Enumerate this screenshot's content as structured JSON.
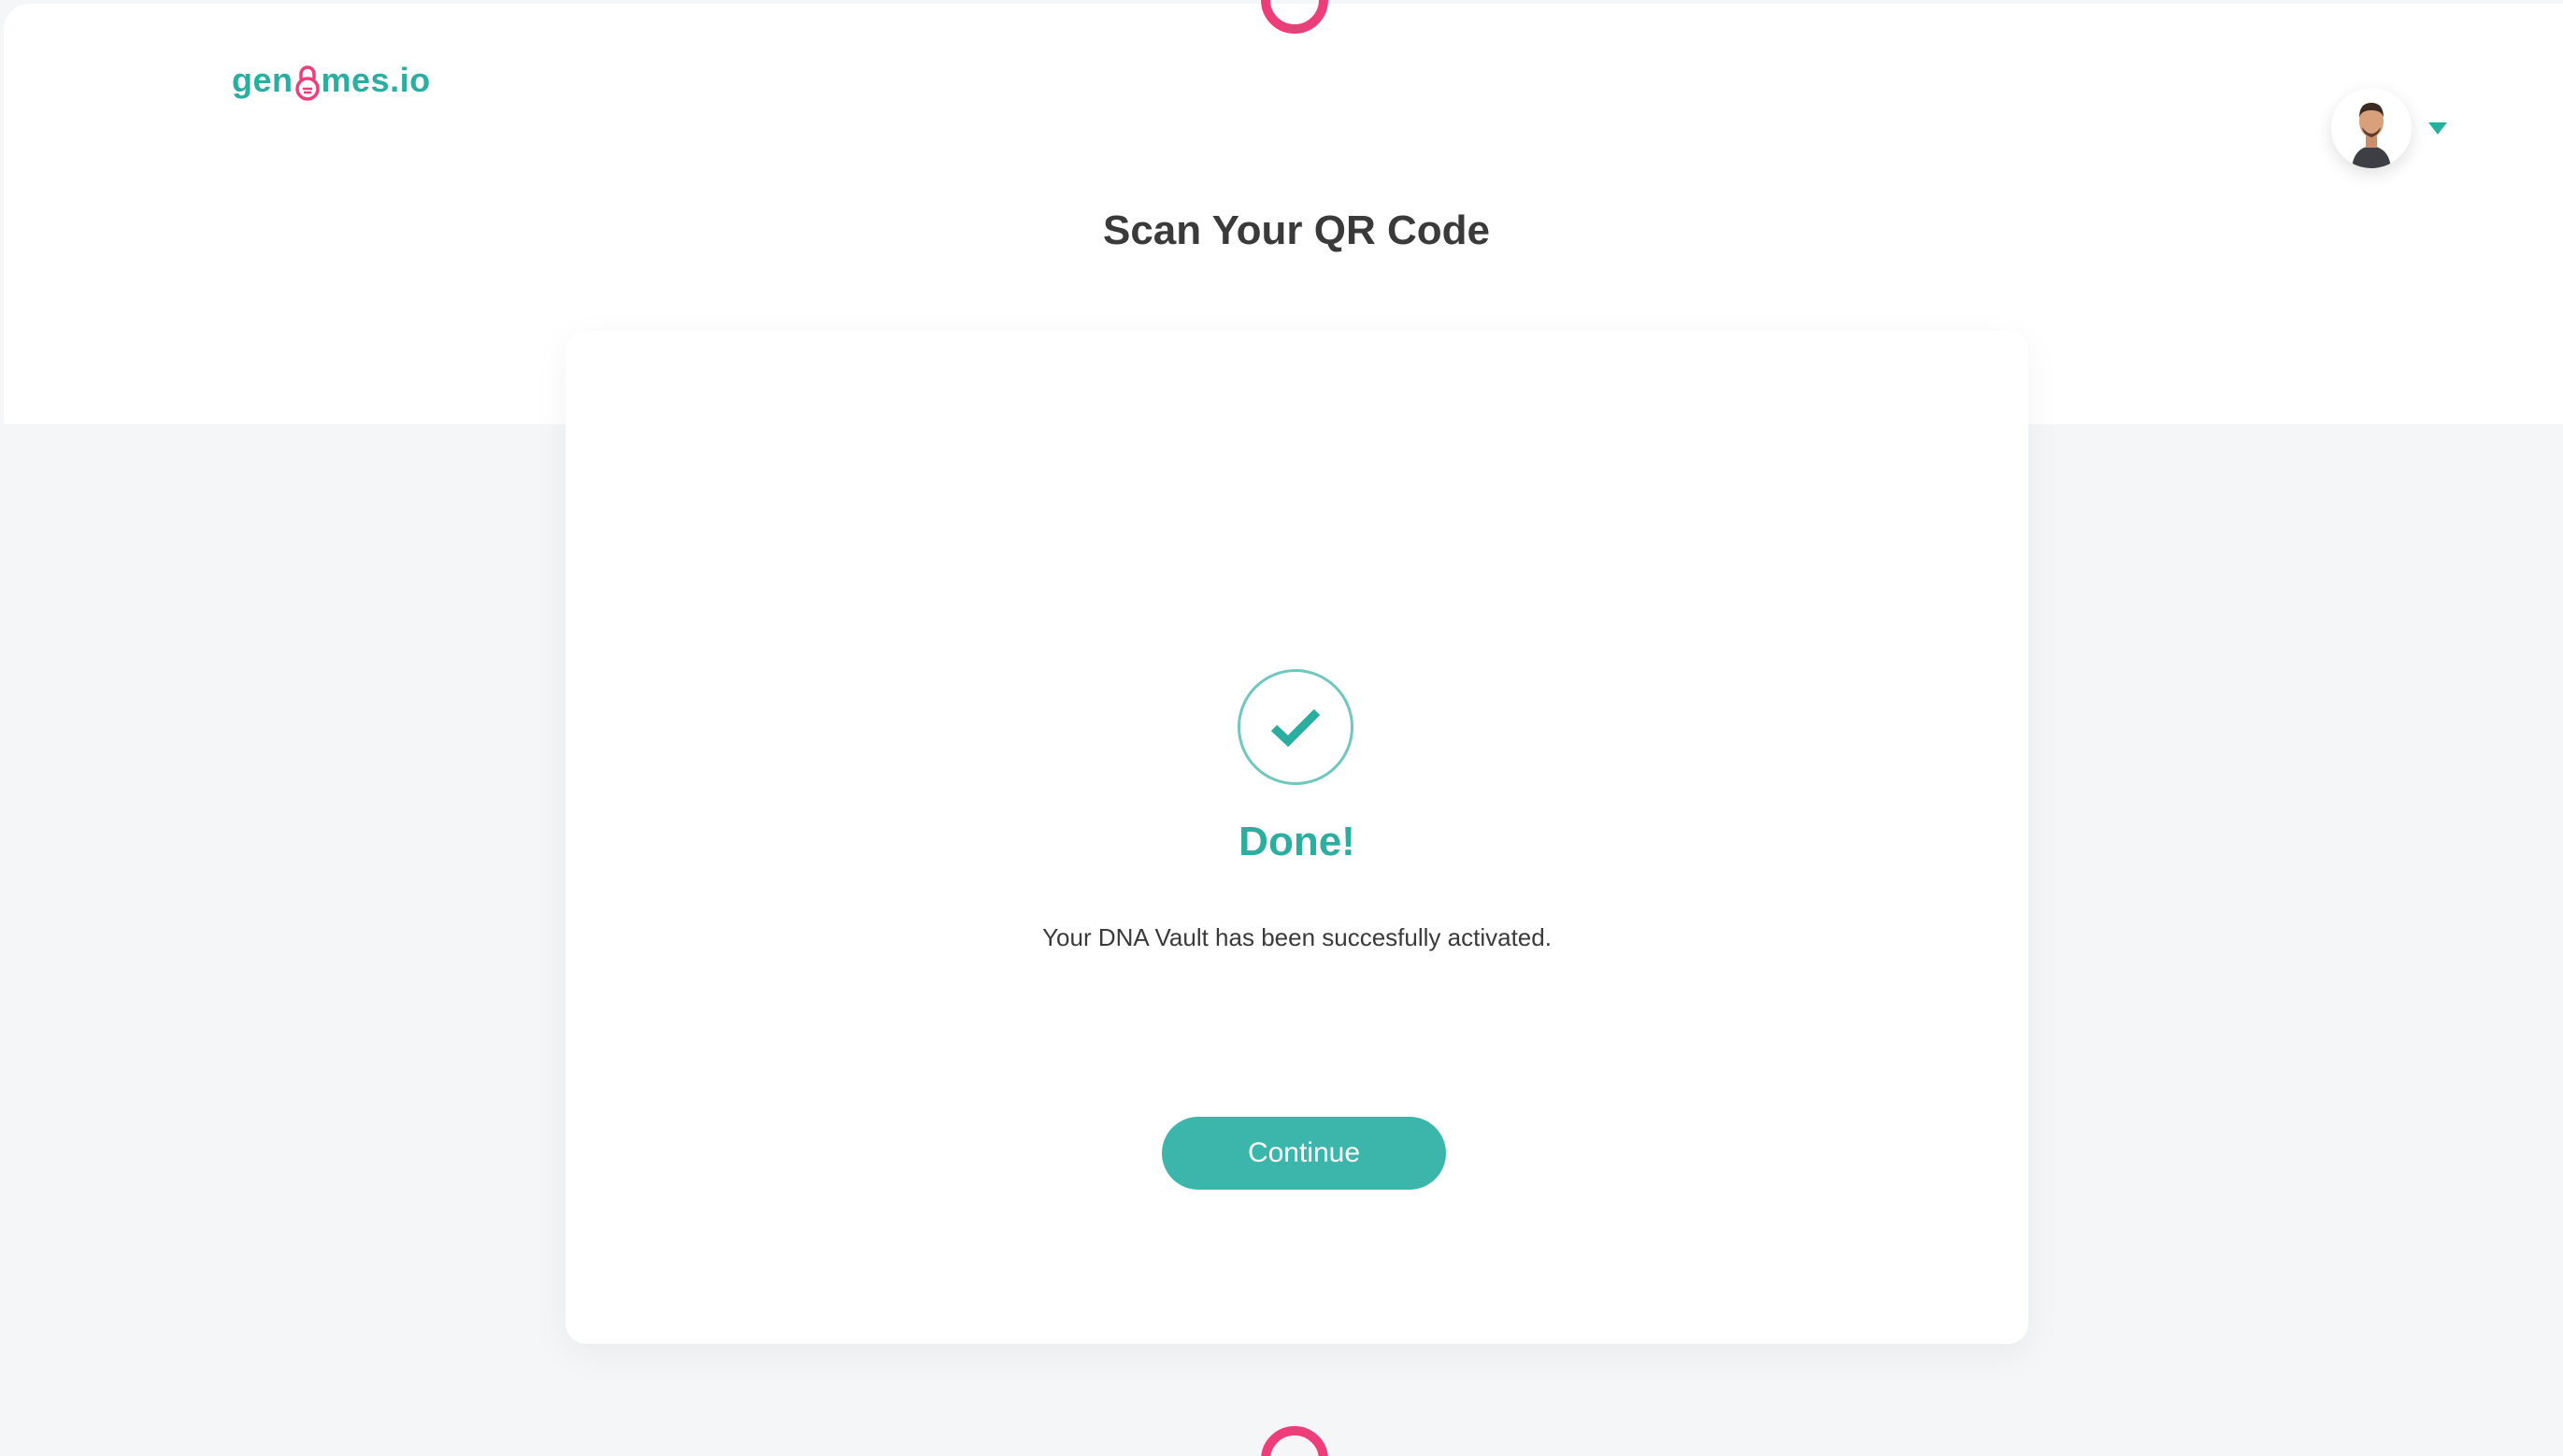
{
  "header": {
    "logo_left": "gen",
    "logo_right": "mes.io",
    "avatar_icon": "user-avatar",
    "menu_icon": "caret-down-icon"
  },
  "page": {
    "title": "Scan Your QR Code"
  },
  "card": {
    "status_icon": "checkmark-icon",
    "heading": "Done!",
    "message": "Your DNA Vault has been succesfully activated.",
    "continue_label": "Continue"
  },
  "colors": {
    "brand_teal": "#2bada0",
    "button_teal": "#3cb5aa",
    "accent_pink": "#ee3e79",
    "background": "#f4f6f7"
  }
}
